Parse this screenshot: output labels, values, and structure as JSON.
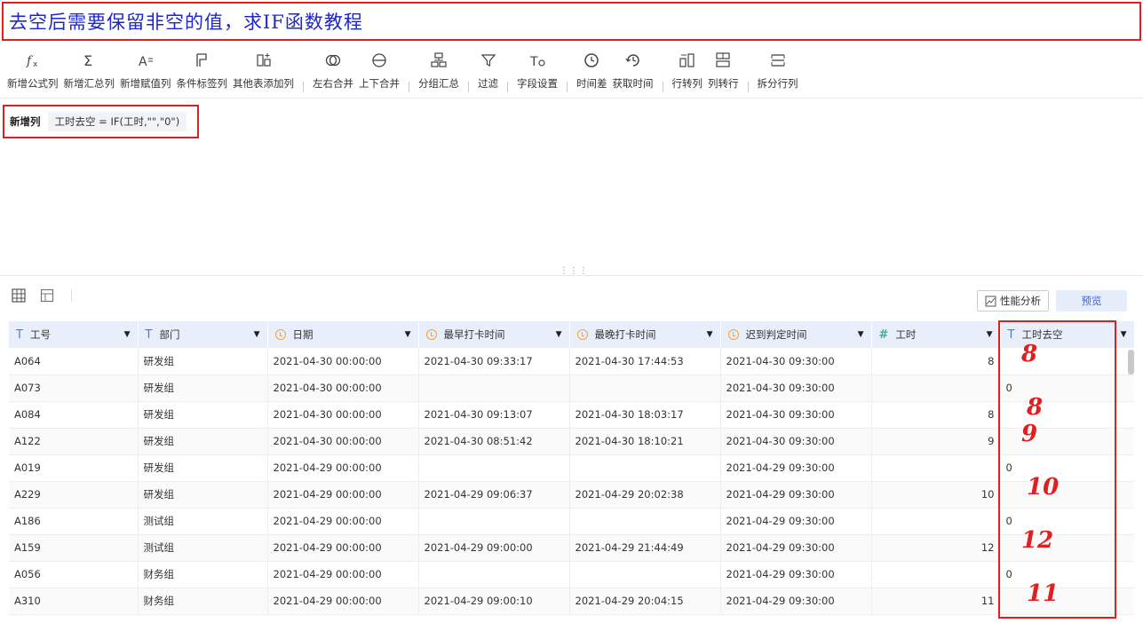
{
  "title": "去空后需要保留非空的值，求IF函数教程",
  "toolbar": {
    "groups": [
      [
        {
          "name": "add-formula-column",
          "label": "新增公式列",
          "icon": "fx-icon"
        },
        {
          "name": "add-summary-column",
          "label": "新增汇总列",
          "icon": "sigma-icon"
        },
        {
          "name": "add-assign-column",
          "label": "新增赋值列",
          "icon": "assign-icon"
        },
        {
          "name": "add-condition-column",
          "label": "条件标签列",
          "icon": "flag-icon"
        },
        {
          "name": "add-other-table-column",
          "label": "其他表添加列",
          "icon": "table-add-icon"
        }
      ],
      [
        {
          "name": "merge-left-right",
          "label": "左右合并",
          "icon": "venn-icon"
        },
        {
          "name": "merge-up-down",
          "label": "上下合并",
          "icon": "stack-merge-icon"
        }
      ],
      [
        {
          "name": "group-summary",
          "label": "分组汇总",
          "icon": "group-icon"
        }
      ],
      [
        {
          "name": "filter",
          "label": "过滤",
          "icon": "filter-icon"
        }
      ],
      [
        {
          "name": "field-settings",
          "label": "字段设置",
          "icon": "field-settings-icon"
        }
      ],
      [
        {
          "name": "time-diff",
          "label": "时间差",
          "icon": "clock-diff-icon"
        },
        {
          "name": "get-time",
          "label": "获取时间",
          "icon": "clock-get-icon"
        }
      ],
      [
        {
          "name": "row-to-column",
          "label": "行转列",
          "icon": "row-to-col-icon"
        },
        {
          "name": "column-to-row",
          "label": "列转行",
          "icon": "col-to-row-icon"
        }
      ],
      [
        {
          "name": "split-row-column",
          "label": "拆分行列",
          "icon": "split-icon"
        }
      ]
    ]
  },
  "formula": {
    "label": "新增列",
    "expression": "工时去空 = IF(工时,\"\",\"0\")"
  },
  "actions": {
    "perf_label": "性能分析",
    "preview_label": "预览"
  },
  "colors": {
    "accent": "#3a64d8",
    "highlight": "#e02020",
    "header_bg": "#e9eefb"
  },
  "table": {
    "columns": [
      {
        "label": "工号",
        "type": "text"
      },
      {
        "label": "部门",
        "type": "text"
      },
      {
        "label": "日期",
        "type": "date"
      },
      {
        "label": "最早打卡时间",
        "type": "date"
      },
      {
        "label": "最晚打卡时间",
        "type": "date"
      },
      {
        "label": "迟到判定时间",
        "type": "date"
      },
      {
        "label": "工时",
        "type": "number"
      },
      {
        "label": "工时去空",
        "type": "text"
      }
    ],
    "rows": [
      [
        "A064",
        "研发组",
        "2021-04-30 00:00:00",
        "2021-04-30 09:33:17",
        "2021-04-30 17:44:53",
        "2021-04-30 09:30:00",
        "8",
        ""
      ],
      [
        "A073",
        "研发组",
        "2021-04-30 00:00:00",
        "",
        "",
        "2021-04-30 09:30:00",
        "",
        "0"
      ],
      [
        "A084",
        "研发组",
        "2021-04-30 00:00:00",
        "2021-04-30 09:13:07",
        "2021-04-30 18:03:17",
        "2021-04-30 09:30:00",
        "8",
        ""
      ],
      [
        "A122",
        "研发组",
        "2021-04-30 00:00:00",
        "2021-04-30 08:51:42",
        "2021-04-30 18:10:21",
        "2021-04-30 09:30:00",
        "9",
        ""
      ],
      [
        "A019",
        "研发组",
        "2021-04-29 00:00:00",
        "",
        "",
        "2021-04-29 09:30:00",
        "",
        "0"
      ],
      [
        "A229",
        "研发组",
        "2021-04-29 00:00:00",
        "2021-04-29 09:06:37",
        "2021-04-29 20:02:38",
        "2021-04-29 09:30:00",
        "10",
        ""
      ],
      [
        "A186",
        "测试组",
        "2021-04-29 00:00:00",
        "",
        "",
        "2021-04-29 09:30:00",
        "",
        "0"
      ],
      [
        "A159",
        "测试组",
        "2021-04-29 00:00:00",
        "2021-04-29 09:00:00",
        "2021-04-29 21:44:49",
        "2021-04-29 09:30:00",
        "12",
        ""
      ],
      [
        "A056",
        "财务组",
        "2021-04-29 00:00:00",
        "",
        "",
        "2021-04-29 09:30:00",
        "",
        "0"
      ],
      [
        "A310",
        "财务组",
        "2021-04-29 00:00:00",
        "2021-04-29 09:00:10",
        "2021-04-29 20:04:15",
        "2021-04-29 09:30:00",
        "11",
        ""
      ]
    ]
  },
  "handwritten": [
    "8",
    "8",
    "9",
    "10",
    "12",
    "11"
  ]
}
